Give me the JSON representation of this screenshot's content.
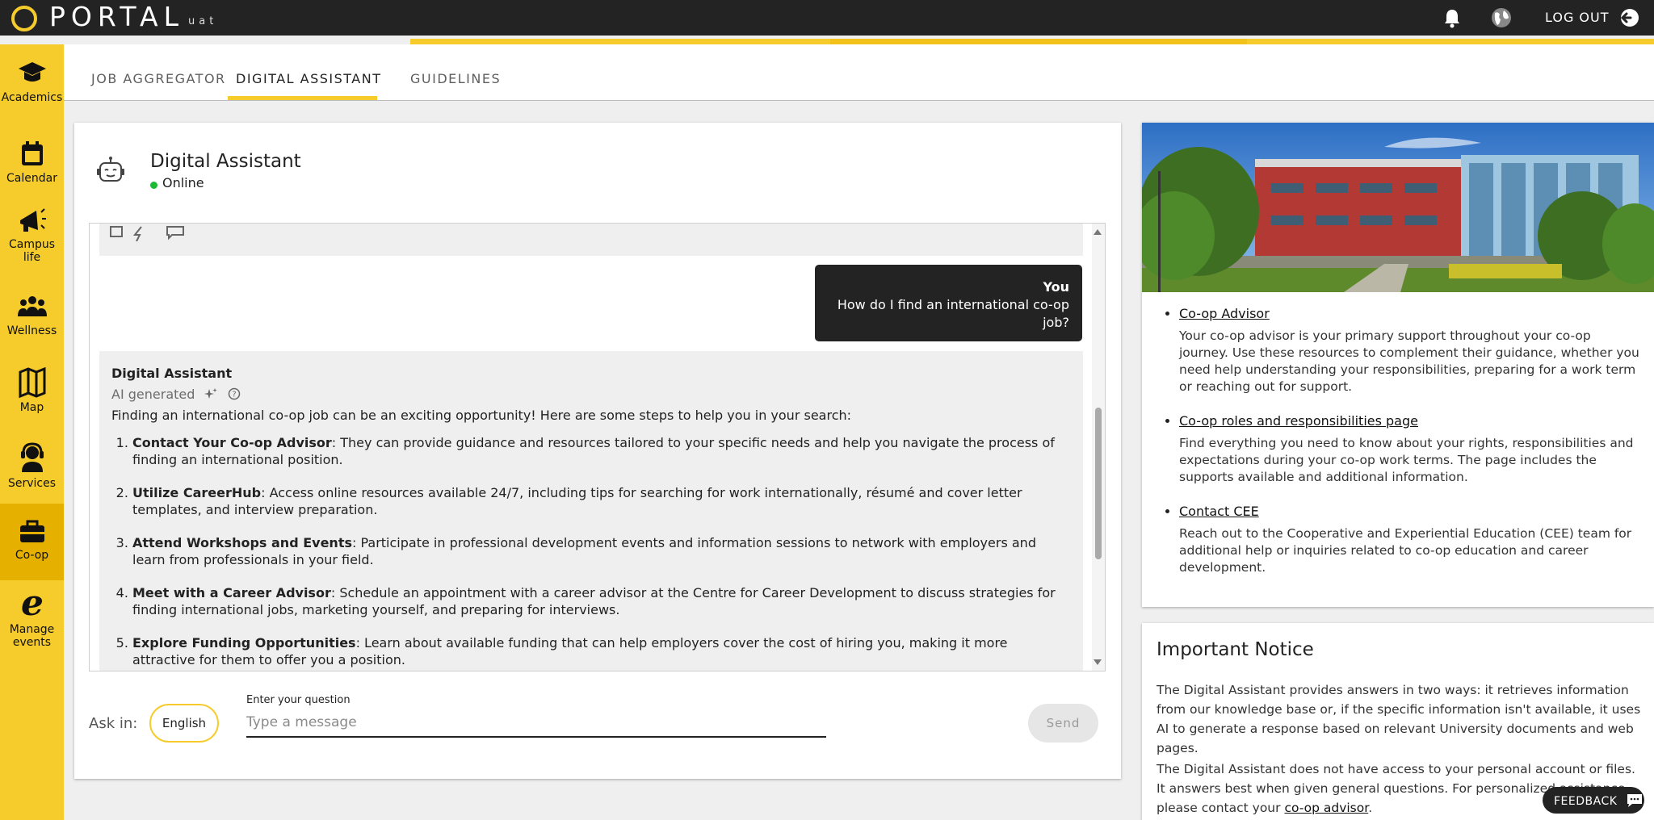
{
  "app": {
    "name": "PORTAL",
    "env": "uat",
    "logout_label": "LOG OUT",
    "accent_color": "#f6cb2c",
    "topbar_color": "#232323"
  },
  "sidebar": {
    "items": [
      {
        "label": "Academics",
        "icon": "graduation-cap-icon"
      },
      {
        "label": "Calendar",
        "icon": "calendar-icon"
      },
      {
        "label": "Campus life",
        "icon": "megaphone-icon"
      },
      {
        "label": "Wellness",
        "icon": "people-icon"
      },
      {
        "label": "Map",
        "icon": "map-icon"
      },
      {
        "label": "Services",
        "icon": "headset-icon"
      },
      {
        "label": "Co-op",
        "icon": "briefcase-icon",
        "active": true
      },
      {
        "label": "Manage events",
        "icon": "e-icon"
      }
    ]
  },
  "tabs": [
    {
      "label": "JOB AGGREGATOR"
    },
    {
      "label": "DIGITAL ASSISTANT",
      "active": true
    },
    {
      "label": "GUIDELINES"
    }
  ],
  "chat": {
    "title": "Digital Assistant",
    "status": "Online",
    "user_message": {
      "sender": "You",
      "text": "How do I find an international co-op job?"
    },
    "answer": {
      "sender": "Digital Assistant",
      "ai_label": "AI generated",
      "intro": "Finding an international co-op job can be an exciting opportunity! Here are some steps to help you in your search:",
      "steps": [
        {
          "title": "Contact Your Co-op Advisor",
          "text": ": They can provide guidance and resources tailored to your specific needs and help you navigate the process of finding an international position."
        },
        {
          "title": "Utilize CareerHub",
          "text": ": Access online resources available 24/7, including tips for searching for work internationally, résumé and cover letter templates, and interview preparation."
        },
        {
          "title": "Attend Workshops and Events",
          "text": ": Participate in professional development events and information sessions to network with employers and learn from professionals in your field."
        },
        {
          "title": "Meet with a Career Advisor",
          "text": ": Schedule an appointment with a career advisor at the Centre for Career Development to discuss strategies for finding international jobs, marketing yourself, and preparing for interviews."
        },
        {
          "title": "Explore Funding Opportunities",
          "text": ": Learn about available funding that can help employers cover the cost of hiring you, making it more attractive for them to offer you a position."
        }
      ]
    },
    "ask_label": "Ask in:",
    "language": "English",
    "question_label": "Enter your question",
    "input_placeholder": "Type a message",
    "input_value": "",
    "send_label": "Send"
  },
  "resources": [
    {
      "title": "Co-op Advisor",
      "desc": "Your co-op advisor is your primary support throughout your co-op journey. Use these resources to complement their guidance, whether you need help understanding your responsibilities, preparing for a work term or reaching out for support."
    },
    {
      "title": "Co-op roles and responsibilities page",
      "desc": "Find everything you need to know about your rights, responsibilities and expectations during your co-op work terms. The page includes the supports available and additional information."
    },
    {
      "title": "Contact CEE",
      "desc": "Reach out to the Cooperative and Experiential Education (CEE) team for additional help or inquiries related to co-op education and career development."
    }
  ],
  "notice": {
    "title": "Important Notice",
    "p1": "The Digital Assistant provides answers in two ways: it retrieves information from our knowledge base or, if the specific information isn't available, it uses AI to generate a response based on relevant University documents and web pages.",
    "p2_text": "The Digital Assistant does not have access to your personal account or files. It answers best when given general questions. For personalized assistance, please contact your ",
    "p2_link": "co-op advisor",
    "p2_end": "."
  },
  "feedback_label": "FEEDBACK"
}
